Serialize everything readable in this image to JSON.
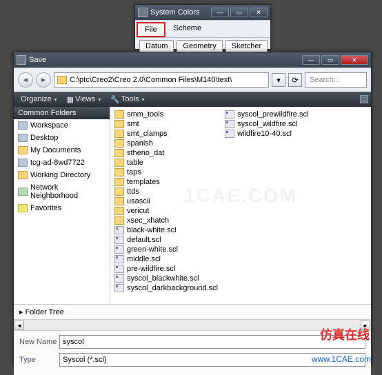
{
  "systemColors": {
    "title": "System Colors",
    "menu": {
      "file": "File",
      "scheme": "Scheme"
    },
    "buttons": {
      "datum": "Datum",
      "geometry": "Geometry",
      "sketcher": "Sketcher"
    }
  },
  "save": {
    "title": "Save",
    "path": "C:\\ptc\\Creo2\\Creo 2.0\\Common Files\\M140\\text\\",
    "search_placeholder": "Search...",
    "toolbar": {
      "organize": "Organize",
      "views": "Views",
      "tools": "Tools"
    },
    "common_folders_label": "Common Folders",
    "sidebar": [
      {
        "label": "Workspace",
        "icon": "ico-drive"
      },
      {
        "label": "Desktop",
        "icon": "ico-drive"
      },
      {
        "label": "My Documents",
        "icon": "ico-folder"
      },
      {
        "label": "tcg-ad-8wd7722",
        "icon": "ico-drive"
      },
      {
        "label": "Working Directory",
        "icon": "ico-folder"
      },
      {
        "label": "Network Neighborhood",
        "icon": "ico-net"
      },
      {
        "label": "Favorites",
        "icon": "ico-star"
      }
    ],
    "folders": [
      "smm_tools",
      "smt",
      "smt_clamps",
      "spanish",
      "stheno_dat",
      "table",
      "taps",
      "templates",
      "ttds",
      "usascii",
      "vericut",
      "xsec_xhatch"
    ],
    "scl_files": [
      "black-white.scl",
      "default.scl",
      "green-white.scl",
      "middle.scl",
      "pre-wildfire.scl",
      "syscol_blackwhite.scl",
      "syscol_darkbackground.scl"
    ],
    "right_files": [
      "syscol_prewildfire.scl",
      "syscol_wildfire.scl",
      "wildfire10-40.scl"
    ],
    "folder_tree": "Folder Tree",
    "new_name_label": "New Name",
    "new_name_value": "syscol",
    "type_label": "Type",
    "type_value": "Syscol (*.scl)"
  },
  "watermark": {
    "cn": "仿真在线",
    "url": "www.1CAE.com",
    "bg": "1CAE.COM"
  }
}
